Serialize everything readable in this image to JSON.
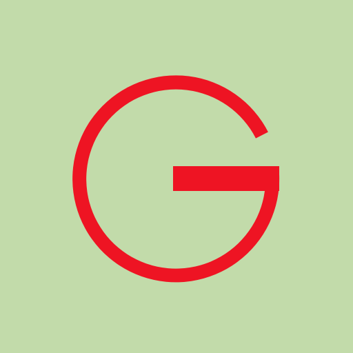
{
  "logo": {
    "glyph": "G",
    "icon": "letter-g-logo-icon"
  },
  "colors": {
    "background": "#c2dbaa",
    "accent": "#ee1423"
  }
}
